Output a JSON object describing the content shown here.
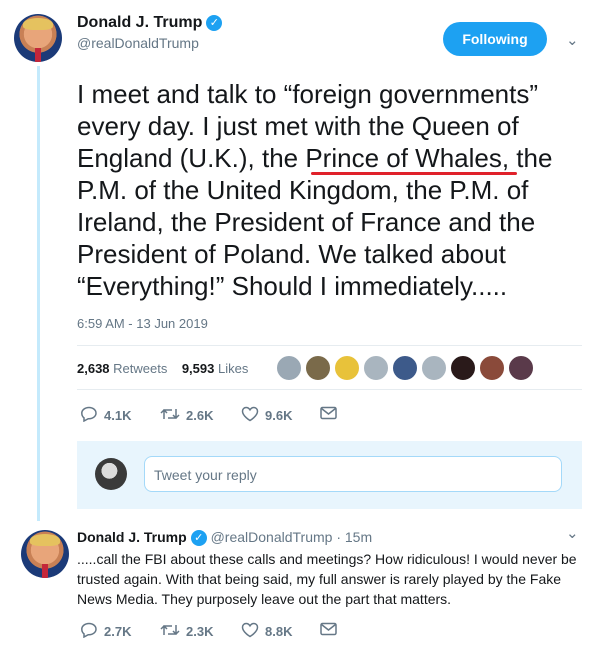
{
  "tweet": {
    "author_name": "Donald J. Trump",
    "author_handle": "@realDonaldTrump",
    "follow_label": "Following",
    "text": "I meet and talk to “foreign governments” every day. I just met with the Queen of England (U.K.), the Prince of Whales, the P.M. of the United Kingdom, the P.M. of Ireland, the President of France and the President of Poland. We talked about “Everything!” Should I immediately.....",
    "highlighted_phrase": "Prince of Whales",
    "highlight_color": "#e0212a",
    "timestamp": "6:59 AM - 13 Jun 2019",
    "retweets_count": "2,638",
    "retweets_label": "Retweets",
    "likes_count": "9,593",
    "likes_label": "Likes",
    "likers_avatars": 9,
    "actions": {
      "replies": "4.1K",
      "retweets": "2.6K",
      "likes": "9.6K"
    }
  },
  "reply_box": {
    "placeholder": "Tweet your reply"
  },
  "reply_tweet": {
    "author_name": "Donald J. Trump",
    "author_handle": "@realDonaldTrump",
    "time": "15m",
    "text": ".....call the FBI about these calls and meetings? How ridiculous! I would never be trusted again. With that being said, my full answer is rarely played by the Fake News Media. They purposely leave out the part that matters.",
    "actions": {
      "replies": "2.7K",
      "retweets": "2.3K",
      "likes": "8.8K"
    }
  },
  "colors": {
    "accent": "#1da1f2",
    "thread_line": "#c4eafc",
    "muted": "#657786"
  }
}
